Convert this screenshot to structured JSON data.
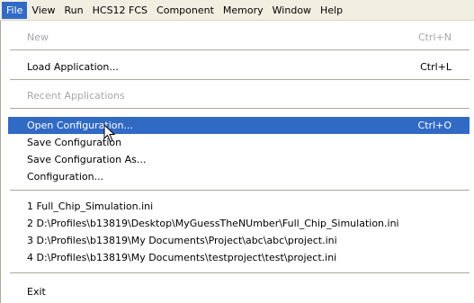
{
  "menubar": {
    "items": [
      {
        "label": "File",
        "active": true
      },
      {
        "label": "View"
      },
      {
        "label": "Run"
      },
      {
        "label": "HCS12 FCS"
      },
      {
        "label": "Component"
      },
      {
        "label": "Memory"
      },
      {
        "label": "Window"
      },
      {
        "label": "Help"
      }
    ]
  },
  "file_menu": {
    "new": {
      "label": "New",
      "shortcut": "Ctrl+N"
    },
    "load_application": {
      "label": "Load Application...",
      "shortcut": "Ctrl+L"
    },
    "recent_applications": {
      "label": "Recent Applications"
    },
    "open_configuration": {
      "label": "Open Configuration...",
      "shortcut": "Ctrl+O"
    },
    "save_configuration": {
      "label": "Save Configuration"
    },
    "save_configuration_as": {
      "label": "Save Configuration As..."
    },
    "configuration": {
      "label": "Configuration..."
    },
    "recent_files": [
      "1 Full_Chip_Simulation.ini",
      "2 D:\\Profiles\\b13819\\Desktop\\MyGuessTheNUmber\\Full_Chip_Simulation.ini",
      "3 D:\\Profiles\\b13819\\My Documents\\Project\\abc\\abc\\project.ini",
      "4 D:\\Profiles\\b13819\\My Documents\\testproject\\test\\project.ini"
    ],
    "exit": {
      "label": "Exit"
    }
  },
  "colors": {
    "highlight": "#316ac5",
    "menubar_bg": "#f1efe2",
    "disabled_text": "#a7a6aa"
  }
}
